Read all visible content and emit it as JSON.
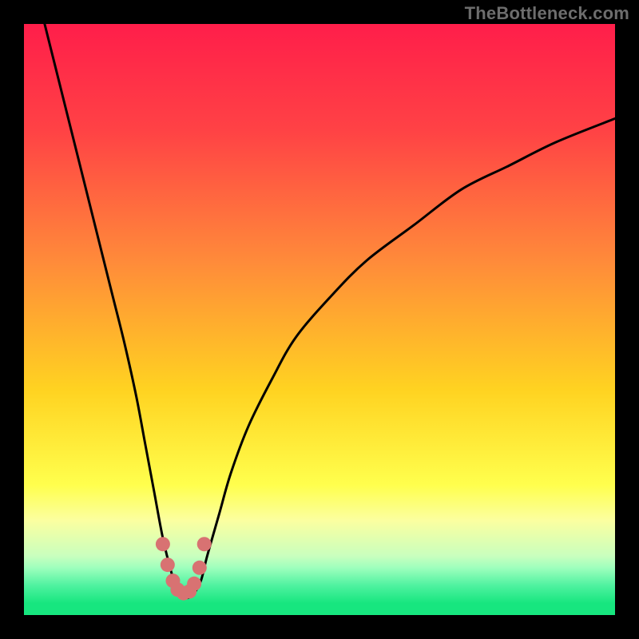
{
  "attribution": "TheBottleneck.com",
  "colors": {
    "black": "#000000",
    "curve": "#000000",
    "marker": "#d87272",
    "green": "#17e67f"
  },
  "gradient_stops": [
    {
      "pct": 0,
      "color": "#ff1e4a"
    },
    {
      "pct": 18,
      "color": "#ff4245"
    },
    {
      "pct": 40,
      "color": "#ff8a3a"
    },
    {
      "pct": 62,
      "color": "#ffd321"
    },
    {
      "pct": 78,
      "color": "#ffff4d"
    },
    {
      "pct": 84,
      "color": "#fbffa0"
    },
    {
      "pct": 90,
      "color": "#c9ffbe"
    },
    {
      "pct": 92,
      "color": "#9effbd"
    },
    {
      "pct": 95,
      "color": "#4ff2a0"
    },
    {
      "pct": 98,
      "color": "#17e67f"
    },
    {
      "pct": 100,
      "color": "#17e67f"
    }
  ],
  "chart_data": {
    "type": "line",
    "title": "",
    "xlabel": "",
    "ylabel": "",
    "xlim": [
      0,
      100
    ],
    "ylim": [
      0,
      100
    ],
    "series": [
      {
        "name": "bottleneck-curve",
        "x": [
          3,
          5,
          7,
          9,
          11,
          13,
          15,
          17,
          19,
          20.5,
          22,
          23.5,
          25,
          26,
          27,
          28,
          29,
          30,
          31,
          33,
          35,
          38,
          42,
          46,
          52,
          58,
          66,
          74,
          82,
          90,
          100
        ],
        "y": [
          102,
          94,
          86,
          78,
          70,
          62,
          54,
          46,
          37,
          29,
          21,
          13,
          7,
          4,
          3,
          3,
          4,
          6,
          10,
          17,
          24,
          32,
          40,
          47,
          54,
          60,
          66,
          72,
          76,
          80,
          84
        ]
      }
    ],
    "markers": {
      "name": "highlight-points",
      "x": [
        23.5,
        24.3,
        25.2,
        26.0,
        27.0,
        28.0,
        28.8,
        29.7,
        30.5
      ],
      "y": [
        12.0,
        8.5,
        5.8,
        4.3,
        3.7,
        4.0,
        5.3,
        8.0,
        12.0
      ]
    }
  }
}
